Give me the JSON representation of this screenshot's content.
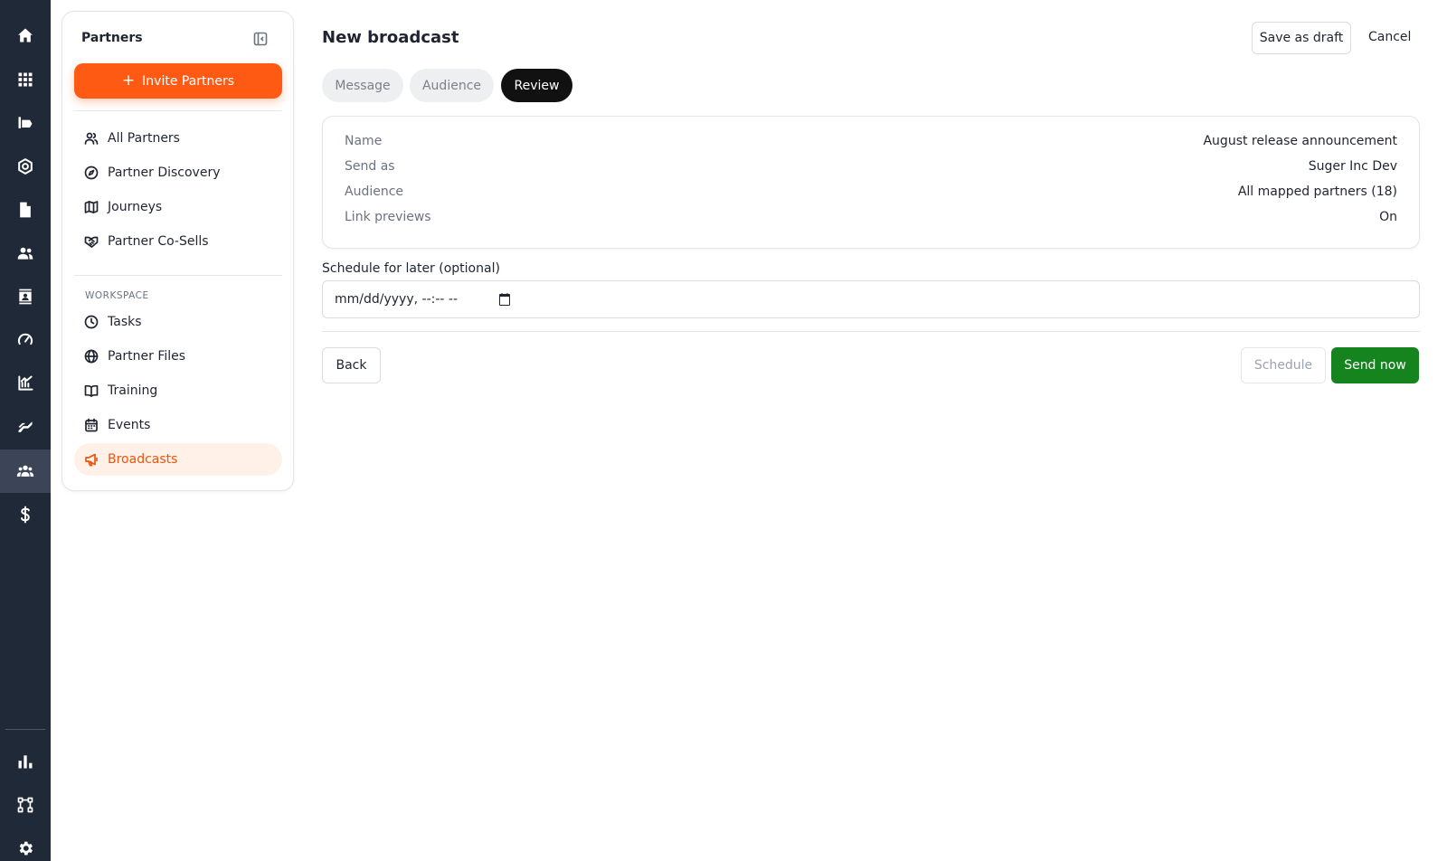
{
  "rail": {
    "icons": [
      "home-icon",
      "apps-grid-icon",
      "marketplace-icon",
      "settings-gear-icon",
      "document-icon",
      "users-icon",
      "contact-card-icon",
      "gauge-icon",
      "analytics-icon",
      "handshake-icon",
      "partners-icon",
      "dollar-icon",
      "bar-chart-icon",
      "workflow-icon",
      "settings-icon"
    ],
    "active": "partners-icon"
  },
  "sidebar": {
    "title": "Partners",
    "invite_label": "Invite Partners",
    "items": [
      {
        "label": "All Partners",
        "icon": "users-icon"
      },
      {
        "label": "Partner Discovery",
        "icon": "compass-icon"
      },
      {
        "label": "Journeys",
        "icon": "map-icon"
      },
      {
        "label": "Partner Co-Sells",
        "icon": "handshake-icon"
      }
    ],
    "workspace_label": "WORKSPACE",
    "workspace_items": [
      {
        "label": "Tasks",
        "icon": "clock-icon"
      },
      {
        "label": "Partner Files",
        "icon": "globe-icon"
      },
      {
        "label": "Training",
        "icon": "book-icon"
      },
      {
        "label": "Events",
        "icon": "calendar-icon"
      },
      {
        "label": "Broadcasts",
        "icon": "megaphone-icon",
        "active": true
      }
    ]
  },
  "header": {
    "title": "New broadcast",
    "save_draft_label": "Save as draft",
    "cancel_label": "Cancel"
  },
  "tabs": [
    {
      "label": "Message",
      "active": false
    },
    {
      "label": "Audience",
      "active": false
    },
    {
      "label": "Review",
      "active": true
    }
  ],
  "review": {
    "rows": [
      {
        "label": "Name",
        "value": "August release announcement"
      },
      {
        "label": "Send as",
        "value": "Suger Inc Dev"
      },
      {
        "label": "Audience",
        "value": "All mapped partners (18)"
      },
      {
        "label": "Link previews",
        "value": "On"
      }
    ]
  },
  "schedule": {
    "label": "Schedule for later (optional)",
    "placeholder": "mm/dd/yyyy, --:-- --"
  },
  "footer": {
    "back_label": "Back",
    "schedule_label": "Schedule",
    "send_label": "Send now"
  },
  "colors": {
    "accent": "#fe5a14",
    "rail_bg": "#1f2937",
    "send_green": "#15841e",
    "active_tab": "#111111"
  }
}
